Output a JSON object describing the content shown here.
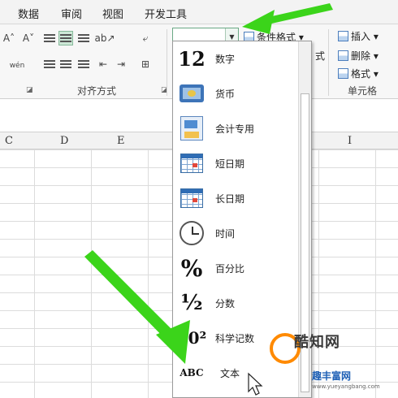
{
  "menu_tabs": [
    "数据",
    "审阅",
    "视图",
    "开发工具"
  ],
  "ribbon": {
    "alignment_group_label": "对齐方式",
    "cells_group_label": "单元格",
    "conditional_format_label": "条件格式",
    "style_partial_label": "式",
    "insert_label": "插入",
    "delete_label": "删除",
    "format_label": "格式",
    "number_format_value": ""
  },
  "columns": [
    {
      "letter": "C"
    },
    {
      "letter": "D"
    },
    {
      "letter": "E"
    },
    {
      "letter": "I"
    }
  ],
  "number_formats": [
    {
      "label": "数字",
      "icon": "number-12-icon",
      "glyph": "12"
    },
    {
      "label": "货币",
      "icon": "currency-icon",
      "glyph": ""
    },
    {
      "label": "会计专用",
      "icon": "accounting-icon",
      "glyph": ""
    },
    {
      "label": "短日期",
      "icon": "calendar-icon",
      "glyph": ""
    },
    {
      "label": "长日期",
      "icon": "calendar-icon",
      "glyph": ""
    },
    {
      "label": "时间",
      "icon": "clock-icon",
      "glyph": ""
    },
    {
      "label": "百分比",
      "icon": "percent-icon",
      "glyph": "%"
    },
    {
      "label": "分数",
      "icon": "fraction-icon",
      "glyph": "½"
    },
    {
      "label": "科学记数",
      "icon": "scientific-icon",
      "glyph": "10²"
    },
    {
      "label": "文本",
      "icon": "text-abc-icon",
      "glyph": "ABC"
    }
  ],
  "watermark": {
    "site_name": "酷知网",
    "brand": "趣丰富网",
    "url": "www.yueyangbang.com"
  },
  "colors": {
    "accent_green": "#3bd41a",
    "selection_green": "#cde8d7",
    "watermark_orange": "#ff8a00",
    "watermark_blue": "#1d5fb5"
  }
}
